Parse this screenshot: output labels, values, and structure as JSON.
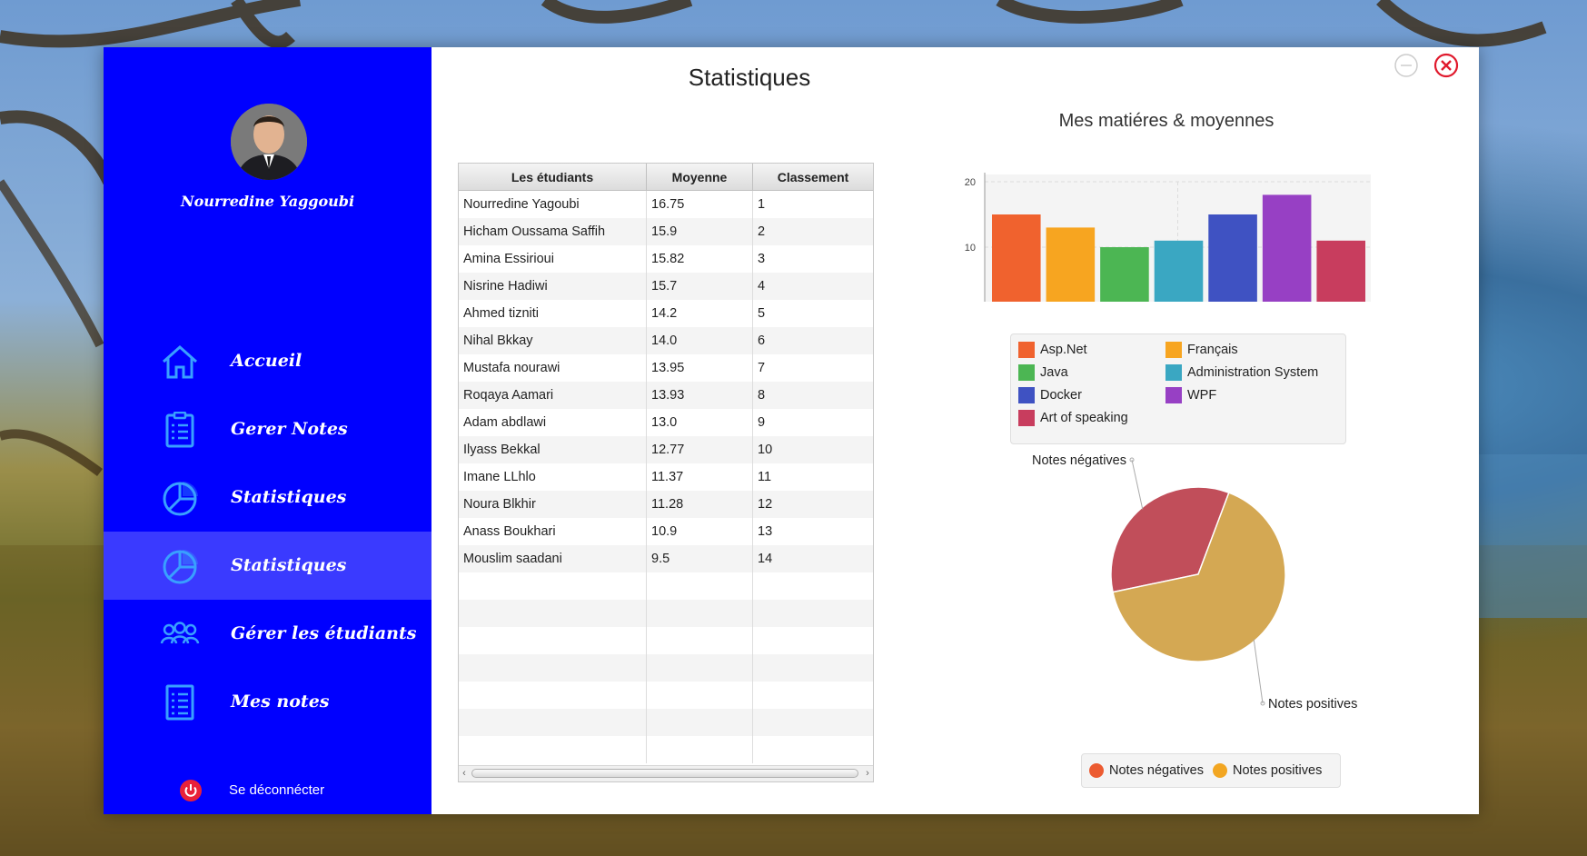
{
  "window": {
    "title": "Statistiques"
  },
  "colors": {
    "sidebar": "#0000ff",
    "sidebar_active": "#3a3aff",
    "close": "#e0192c"
  },
  "sidebar": {
    "user_name": "Nourredine Yaggoubi",
    "items": [
      {
        "label": "Accueil",
        "icon": "home-icon",
        "active": false
      },
      {
        "label": "Gerer Notes",
        "icon": "clipboard-list-icon",
        "active": false
      },
      {
        "label": "Statistiques",
        "icon": "pie-chart-icon",
        "active": false
      },
      {
        "label": "Statistiques",
        "icon": "pie-chart-icon",
        "active": true
      },
      {
        "label": "Gérer les étudiants",
        "icon": "users-icon",
        "active": false
      },
      {
        "label": "Mes notes",
        "icon": "document-list-icon",
        "active": false
      }
    ],
    "logout": {
      "label": "Se déconnécter",
      "icon": "power-icon"
    }
  },
  "table": {
    "headers": [
      "Les étudiants",
      "Moyenne",
      "Classement"
    ],
    "rows": [
      [
        "Nourredine Yagoubi",
        "16.75",
        "1"
      ],
      [
        "Hicham Oussama Saffih",
        "15.9",
        "2"
      ],
      [
        "Amina Essirioui",
        "15.82",
        "3"
      ],
      [
        "Nisrine Hadiwi",
        "15.7",
        "4"
      ],
      [
        "Ahmed tizniti",
        "14.2",
        "5"
      ],
      [
        "Nihal Bkkay",
        "14.0",
        "6"
      ],
      [
        "Mustafa nourawi",
        "13.95",
        "7"
      ],
      [
        "Roqaya Aamari",
        "13.93",
        "8"
      ],
      [
        "Adam abdlawi",
        "13.0",
        "9"
      ],
      [
        "Ilyass Bekkal",
        "12.77",
        "10"
      ],
      [
        "Imane LLhlo",
        "11.37",
        "11"
      ],
      [
        "Noura Blkhir",
        "11.28",
        "12"
      ],
      [
        "Anass Boukhari",
        "10.9",
        "13"
      ],
      [
        "Mouslim saadani",
        "9.5",
        "14"
      ]
    ],
    "empty_rows": 7
  },
  "chart_data": [
    {
      "type": "bar",
      "title": "Mes matiéres & moyennes",
      "ylim": [
        0,
        20
      ],
      "yticks": [
        "0",
        "10",
        "20"
      ],
      "grid": true,
      "legend_position": "bottom",
      "series": [
        {
          "name": "Asp.Net",
          "value": 15,
          "color": "#f0622e"
        },
        {
          "name": "Français",
          "value": 13,
          "color": "#f7a520"
        },
        {
          "name": "Java",
          "value": 10,
          "color": "#4cb653"
        },
        {
          "name": "Administration System",
          "value": 11,
          "color": "#3aa7c2"
        },
        {
          "name": "Docker",
          "value": 15,
          "color": "#3f52c2"
        },
        {
          "name": "WPF",
          "value": 18,
          "color": "#9740c4"
        },
        {
          "name": "Art of speaking",
          "value": 11,
          "color": "#c83d5e"
        }
      ]
    },
    {
      "type": "pie",
      "legend_position": "bottom",
      "series": [
        {
          "name": "Notes négatives",
          "value": 34,
          "color": "#c14e5a",
          "legend_color": "#ec5b31"
        },
        {
          "name": "Notes positives",
          "value": 66,
          "color": "#d4a853",
          "legend_color": "#f2a622"
        }
      ]
    }
  ]
}
